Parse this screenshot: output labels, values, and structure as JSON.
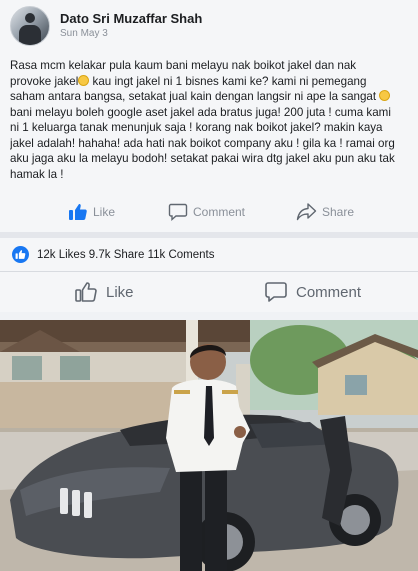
{
  "post": {
    "author": "Dato Sri Muzaffar Shah",
    "time": "Sun May 3",
    "lines": [
      "Rasa mcm kelakar pula kaum bani melayu nak boikot jakel dan nak",
      "provoke jakel",
      " kau ingt jakel ni 1 bisnes kami ke? kami ni pemegang",
      "saham antara bangsa, setakat jual kain dengan langsir ni ape la sangat",
      "bani melayu boleh google aset jakel ada bratus juga! 200 juta ! cuma kami",
      "ni 1 keluarga tanak menunjuk saja ! korang nak boikot jakel? makin kaya",
      "jakel adalah! hahaha! ada hati nak boikot company aku ! gila ka ! ramai org",
      "aku jaga aku la melayu bodoh! setakat pakai wira dtg jakel aku pun aku tak",
      "hamak la !"
    ],
    "actions": {
      "like": "Like",
      "comment": "Comment",
      "share": "Share"
    }
  },
  "stats": {
    "text": "12k Likes 9.7k Share 11k Coments"
  },
  "bottom_actions": {
    "like": "Like",
    "comment": "Comment"
  },
  "colors": {
    "facebook_blue": "#1877f2",
    "muted_text": "#8a9099"
  },
  "icons": {
    "avatar": "profile-avatar",
    "like": "thumbs-up-icon",
    "comment": "speech-bubble-icon",
    "share": "share-arrow-icon"
  }
}
